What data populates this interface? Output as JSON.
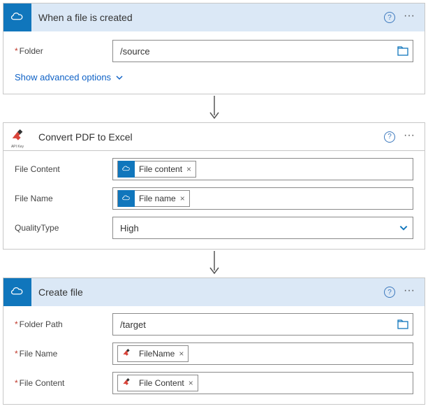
{
  "step1": {
    "title": "When a file is created",
    "folder_label": "Folder",
    "folder_value": "/source",
    "advanced_link": "Show advanced options"
  },
  "step2": {
    "title": "Convert PDF to Excel",
    "api_key_label": "API Key",
    "file_content_label": "File Content",
    "file_content_token": "File content",
    "file_name_label": "File Name",
    "file_name_token": "File name",
    "quality_label": "QualityType",
    "quality_value": "High"
  },
  "step3": {
    "title": "Create file",
    "folder_path_label": "Folder Path",
    "folder_path_value": "/target",
    "file_name_label": "File Name",
    "file_name_token": "FileName",
    "file_content_label": "File Content",
    "file_content_token": "File Content"
  }
}
